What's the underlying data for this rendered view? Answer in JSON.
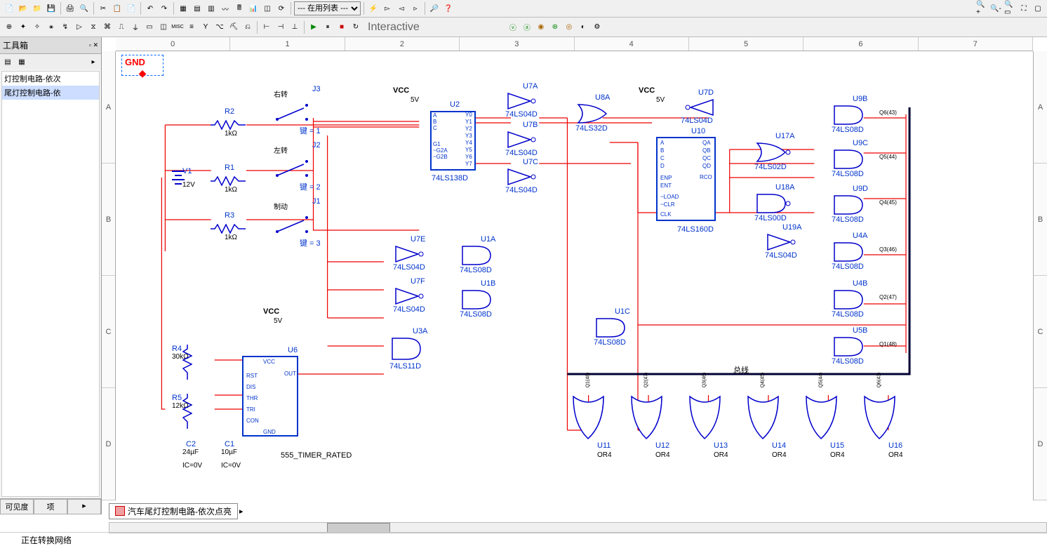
{
  "toolbar1": {
    "dropdown_text": "--- 在用列表 ---"
  },
  "toolbar2": {
    "sim_mode": "Interactive"
  },
  "sidebar": {
    "title": "工具箱",
    "items": [
      "灯控制电路-依次",
      "尾灯控制电路-依"
    ],
    "tabs": [
      "可见度",
      "项"
    ]
  },
  "ruler_cols": [
    "0",
    "1",
    "2",
    "3",
    "4",
    "5",
    "6",
    "7"
  ],
  "ruler_rows": [
    "A",
    "B",
    "C",
    "D"
  ],
  "gnd_label": "GND",
  "schematic": {
    "vcc1": {
      "label": "VCC",
      "val": "5V"
    },
    "vcc2": {
      "label": "VCC",
      "val": "5V"
    },
    "vcc3": {
      "label": "VCC",
      "val": "5V"
    },
    "v1": {
      "name": "V1",
      "val": "12V"
    },
    "r1": {
      "name": "R1",
      "val": "1kΩ"
    },
    "r2": {
      "name": "R2",
      "val": "1kΩ"
    },
    "r3": {
      "name": "R3",
      "val": "1kΩ"
    },
    "r4": {
      "name": "R4",
      "val": "30kΩ"
    },
    "r5": {
      "name": "R5",
      "val": "12kΩ"
    },
    "c1": {
      "name": "C1",
      "val": "10µF",
      "ic": "IC=0V"
    },
    "c2": {
      "name": "C2",
      "val": "24µF",
      "ic": "IC=0V"
    },
    "j1": {
      "name": "J1",
      "lbl": "制动",
      "key": "键 = 3"
    },
    "j2": {
      "name": "J2",
      "lbl": "左转",
      "key": "键 = 2"
    },
    "j3": {
      "name": "J3",
      "lbl": "右转",
      "key": "键 = 1"
    },
    "u1a": {
      "name": "U1A",
      "part": "74LS08D"
    },
    "u1b": {
      "name": "U1B",
      "part": "74LS08D"
    },
    "u1c": {
      "name": "U1C",
      "part": "74LS08D"
    },
    "u2": {
      "name": "U2",
      "part": "74LS138D",
      "pins_l": [
        "A",
        "B",
        "C",
        "G1",
        "~G2A",
        "~G2B"
      ],
      "pins_r": [
        "Y0",
        "Y1",
        "Y2",
        "Y3",
        "Y4",
        "Y5",
        "Y6",
        "Y7"
      ]
    },
    "u3a": {
      "name": "U3A",
      "part": "74LS11D"
    },
    "u4a": {
      "name": "U4A",
      "part": "74LS08D"
    },
    "u4b": {
      "name": "U4B",
      "part": "74LS08D"
    },
    "u5b": {
      "name": "U5B",
      "part": "74LS08D"
    },
    "u6": {
      "name": "U6",
      "part": "555_TIMER_RATED",
      "pins": [
        "VCC",
        "RST",
        "DIS",
        "THR",
        "TRI",
        "CON",
        "OUT",
        "GND"
      ]
    },
    "u7a": {
      "name": "U7A",
      "part": "74LS04D"
    },
    "u7b": {
      "name": "U7B",
      "part": "74LS04D"
    },
    "u7c": {
      "name": "U7C",
      "part": "74LS04D"
    },
    "u7d": {
      "name": "U7D",
      "part": "74LS04D"
    },
    "u7e": {
      "name": "U7E",
      "part": "74LS04D"
    },
    "u7f": {
      "name": "U7F",
      "part": "74LS04D"
    },
    "u8a": {
      "name": "U8A",
      "part": "74LS32D"
    },
    "u9b": {
      "name": "U9B",
      "part": "74LS08D"
    },
    "u9c": {
      "name": "U9C",
      "part": "74LS08D"
    },
    "u9d": {
      "name": "U9D",
      "part": "74LS08D"
    },
    "u10": {
      "name": "U10",
      "part": "74LS160D",
      "pins_l": [
        "A",
        "B",
        "C",
        "D",
        "ENP",
        "ENT",
        "~LOAD",
        "~CLR",
        "CLK"
      ],
      "pins_r": [
        "QA",
        "QB",
        "QC",
        "QD",
        "RCO"
      ]
    },
    "u11": {
      "name": "U11",
      "part": "OR4"
    },
    "u12": {
      "name": "U12",
      "part": "OR4"
    },
    "u13": {
      "name": "U13",
      "part": "OR4"
    },
    "u14": {
      "name": "U14",
      "part": "OR4"
    },
    "u15": {
      "name": "U15",
      "part": "OR4"
    },
    "u16": {
      "name": "U16",
      "part": "OR4"
    },
    "u17a": {
      "name": "U17A",
      "part": "74LS02D"
    },
    "u18a": {
      "name": "U18A",
      "part": "74LS00D"
    },
    "u19a": {
      "name": "U19A",
      "part": "74LS04D"
    },
    "bus_label": "总线",
    "bus_nets": [
      "Q6(43)",
      "Q5(44)",
      "Q4(45)",
      "Q3(46)",
      "Q2(47)",
      "Q1(48)"
    ],
    "or_nets": [
      "Q1(48)",
      "Q2(47)",
      "Q3(46)",
      "Q4(45)",
      "Q5(44)",
      "Q6(43)"
    ]
  },
  "doc_tab": "汽车尾灯控制电路-依次点亮",
  "status_text": "正在转换网络"
}
